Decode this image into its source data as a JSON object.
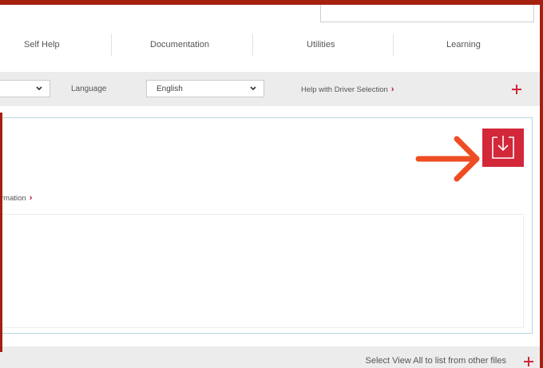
{
  "nav": {
    "items": [
      {
        "label": "Self Help"
      },
      {
        "label": "Documentation"
      },
      {
        "label": "Utilities"
      },
      {
        "label": "Learning"
      }
    ]
  },
  "filters": {
    "language_label": "Language",
    "language_value": "English",
    "help_link": "Help with Driver Selection"
  },
  "panel": {
    "info_link": "rmation"
  },
  "footer": {
    "view_all_text": "Select View All to list from other files"
  },
  "colors": {
    "frame": "#a5200f",
    "accent": "#d3273a",
    "arrow": "#ee4c23",
    "panel_border": "#b6d4e0"
  },
  "icons": {
    "download": "download-icon",
    "arrow": "arrow-right-icon",
    "expand": "plus-icon"
  }
}
